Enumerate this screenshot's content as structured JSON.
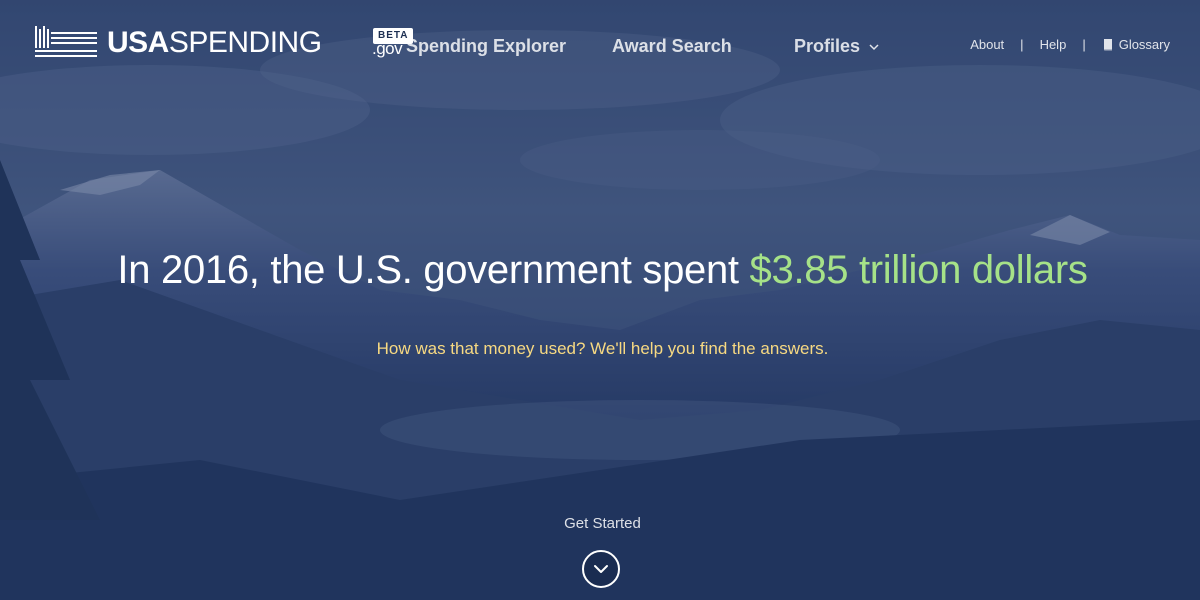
{
  "header": {
    "logo": {
      "usa": "USA",
      "spending": "SPENDING",
      "gov": ".gov",
      "badge": "BETA"
    },
    "nav": {
      "spending_explorer": "Spending Explorer",
      "award_search": "Award Search",
      "profiles": "Profiles"
    },
    "utility": {
      "about": "About",
      "help": "Help",
      "glossary": "Glossary",
      "separator": "|"
    }
  },
  "hero": {
    "headline_prefix": "In 2016, the U.S. government spent ",
    "headline_amount": "$3.85 trillion dollars",
    "subline": "How was that money used? We'll help you find the answers.",
    "cta_label": "Get Started"
  },
  "colors": {
    "accent_green": "#a6e288",
    "accent_gold": "#f7d982",
    "overlay_navy": "#1e325f"
  },
  "icons": {
    "logo_mark": "flag-stripes-icon",
    "profiles_dropdown": "chevron-down-icon",
    "glossary": "book-icon",
    "scroll": "chevron-down-circle-icon"
  }
}
